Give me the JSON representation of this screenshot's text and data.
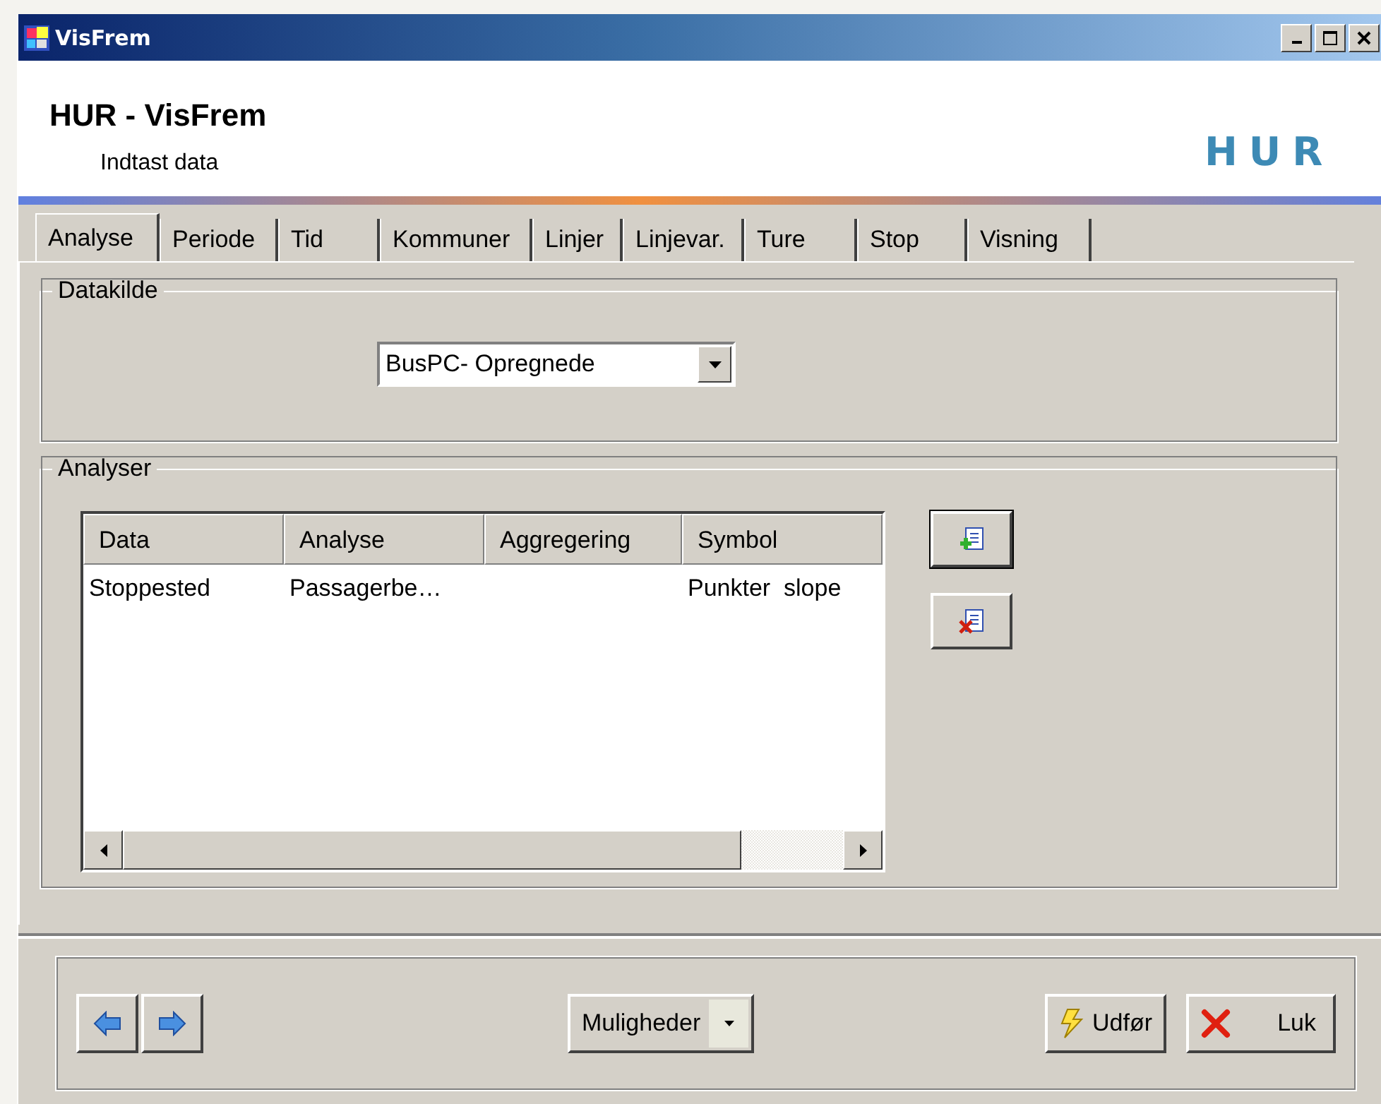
{
  "window": {
    "title": "VisFrem"
  },
  "header": {
    "title": "HUR - VisFrem",
    "subtitle": "Indtast data",
    "logo": "HUR"
  },
  "tabs": [
    {
      "label": "Analyse",
      "selected": true
    },
    {
      "label": "Periode",
      "selected": false
    },
    {
      "label": "Tid",
      "selected": false
    },
    {
      "label": "Kommuner",
      "selected": false
    },
    {
      "label": "Linjer",
      "selected": false
    },
    {
      "label": "Linjevar.",
      "selected": false
    },
    {
      "label": "Ture",
      "selected": false
    },
    {
      "label": "Stop",
      "selected": false
    },
    {
      "label": "Visning",
      "selected": false
    }
  ],
  "datakilde": {
    "label": "Datakilde",
    "value": "BusPC- Opregnede"
  },
  "analyser": {
    "label": "Analyser",
    "columns": [
      "Data",
      "Analyse",
      "Aggregering",
      "Symbol"
    ],
    "rows": [
      [
        "Stoppested",
        "Passagerbe…",
        "",
        "Punkter  slope"
      ]
    ]
  },
  "footer": {
    "options_button": "Muligheder",
    "run_button": "Udfør",
    "close_button": "Luk"
  }
}
